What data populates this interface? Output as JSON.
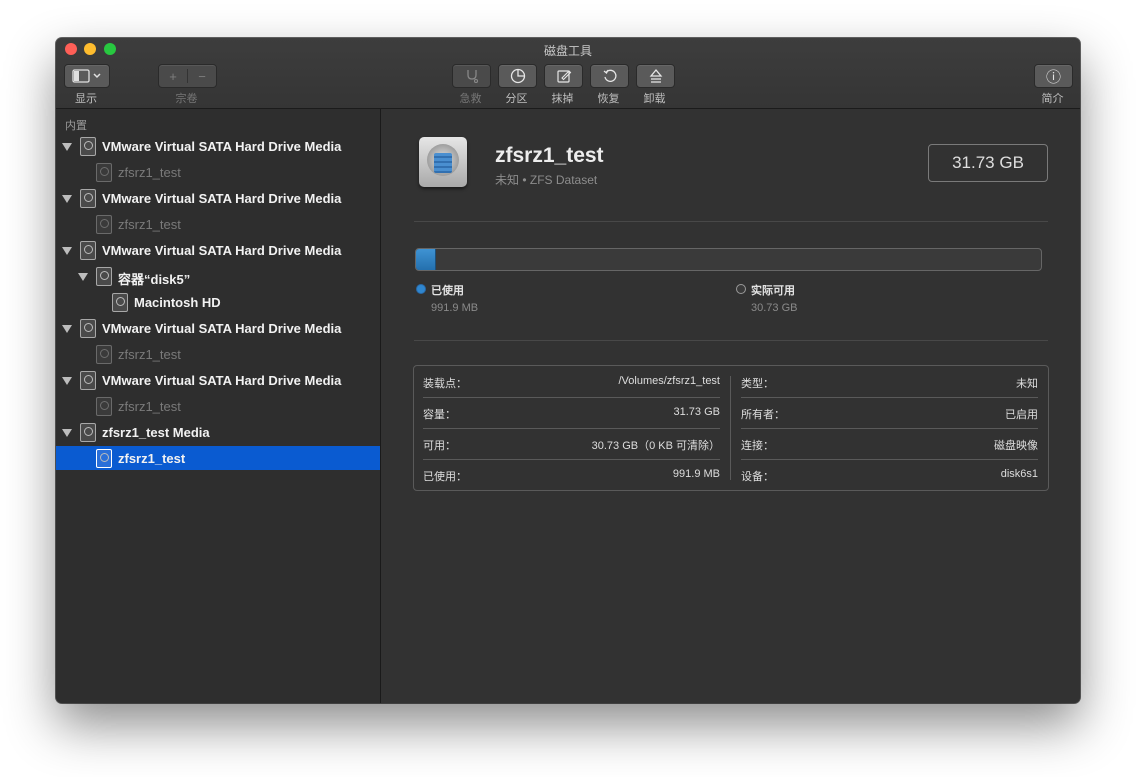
{
  "window": {
    "title": "磁盘工具"
  },
  "toolbar": {
    "view_label": "显示",
    "volume_label": "宗卷",
    "first_aid_label": "急救",
    "partition_label": "分区",
    "erase_label": "抹掉",
    "restore_label": "恢复",
    "unmount_label": "卸载",
    "info_label": "简介",
    "plus_glyph": "+",
    "minus_glyph": "−",
    "info_glyph": "ⓘ"
  },
  "sidebar": {
    "section_label": "内置",
    "rows": [
      {
        "label": "VMware Virtual SATA Hard Drive Media",
        "level": 0,
        "disclosure": true,
        "dim": false,
        "selected": false
      },
      {
        "label": "zfsrz1_test",
        "level": 1,
        "disclosure": false,
        "dim": true,
        "selected": false
      },
      {
        "label": "VMware Virtual SATA Hard Drive Media",
        "level": 0,
        "disclosure": true,
        "dim": false,
        "selected": false
      },
      {
        "label": "zfsrz1_test",
        "level": 1,
        "disclosure": false,
        "dim": true,
        "selected": false
      },
      {
        "label": "VMware Virtual SATA Hard Drive Media",
        "level": 0,
        "disclosure": true,
        "dim": false,
        "selected": false
      },
      {
        "label": "容器“disk5”",
        "level": 1,
        "disclosure": true,
        "dim": false,
        "selected": false
      },
      {
        "label": "Macintosh HD",
        "level": 2,
        "disclosure": false,
        "dim": false,
        "selected": false
      },
      {
        "label": "VMware Virtual SATA Hard Drive Media",
        "level": 0,
        "disclosure": true,
        "dim": false,
        "selected": false
      },
      {
        "label": "zfsrz1_test",
        "level": 1,
        "disclosure": false,
        "dim": true,
        "selected": false
      },
      {
        "label": "VMware Virtual SATA Hard Drive Media",
        "level": 0,
        "disclosure": true,
        "dim": false,
        "selected": false
      },
      {
        "label": "zfsrz1_test",
        "level": 1,
        "disclosure": false,
        "dim": true,
        "selected": false
      },
      {
        "label": "zfsrz1_test Media",
        "level": 0,
        "disclosure": true,
        "dim": false,
        "selected": false
      },
      {
        "label": "zfsrz1_test",
        "level": 1,
        "disclosure": false,
        "dim": false,
        "selected": true
      }
    ]
  },
  "volume": {
    "name": "zfsrz1_test",
    "subtitle": "未知 • ZFS Dataset",
    "size": "31.73 GB"
  },
  "usage": {
    "used_fraction": 0.031,
    "used_label": "已使用",
    "used_value": "991.9 MB",
    "free_label": "实际可用",
    "free_value": "30.73 GB",
    "used_color": "#2f86cf"
  },
  "info": {
    "left": [
      {
        "key": "装载点：",
        "value": "/Volumes/zfsrz1_test"
      },
      {
        "key": "容量：",
        "value": "31.73 GB"
      },
      {
        "key": "可用：",
        "value": "30.73 GB（0 KB 可清除）"
      },
      {
        "key": "已使用：",
        "value": "991.9 MB"
      }
    ],
    "right": [
      {
        "key": "类型：",
        "value": "未知"
      },
      {
        "key": "所有者：",
        "value": "已启用"
      },
      {
        "key": "连接：",
        "value": "磁盘映像"
      },
      {
        "key": "设备：",
        "value": "disk6s1"
      }
    ]
  }
}
